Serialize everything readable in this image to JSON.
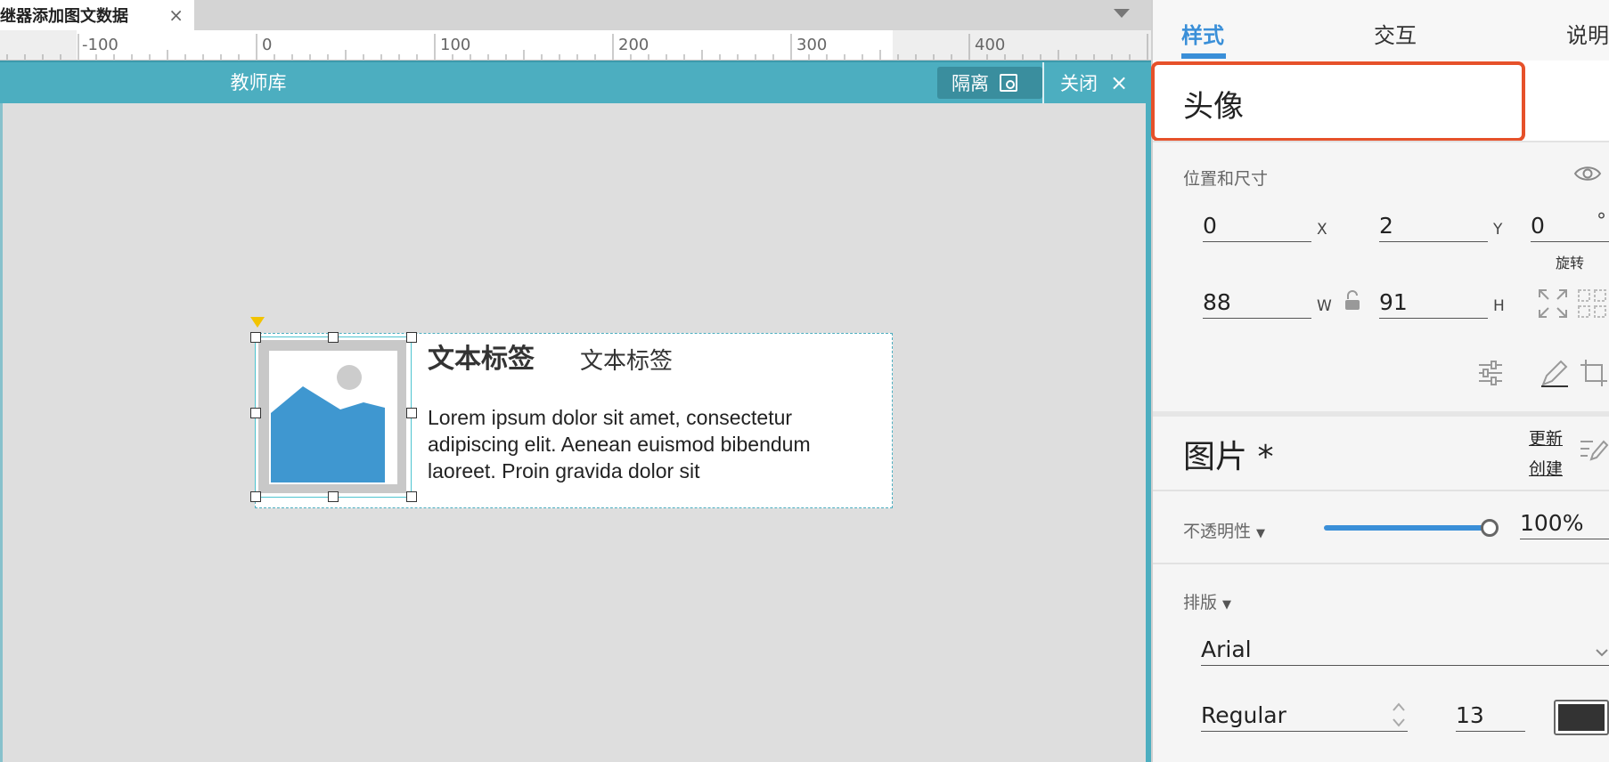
{
  "document_tab": {
    "label": "继器添加图文数据",
    "close": "×"
  },
  "ruler": {
    "labels": [
      "-100",
      "0",
      "100",
      "200",
      "300",
      "400"
    ]
  },
  "isolation_bar": {
    "title": "教师库",
    "isolate_label": "隔离",
    "close_label": "关闭",
    "close_glyph": "×"
  },
  "canvas": {
    "label_bold": "文本标签",
    "label_normal": "文本标签",
    "paragraph": "Lorem ipsum dolor sit amet, consectetur adipiscing elit. Aenean euismod bibendum laoreet. Proin gravida dolor sit"
  },
  "inspector": {
    "tabs": [
      {
        "label": "样式"
      },
      {
        "label": "交互"
      },
      {
        "label": "说明"
      }
    ],
    "widget_name": "头像",
    "position_size": {
      "label": "位置和尺寸",
      "x": "0",
      "x_unit": "X",
      "y": "2",
      "y_unit": "Y",
      "rotation": "0",
      "rotation_unit": "°",
      "rotation_label": "旋转",
      "w": "88",
      "w_unit": "W",
      "h": "91",
      "h_unit": "H"
    },
    "image_section": {
      "title": "图片 *",
      "update_link": "更新",
      "create_link": "创建"
    },
    "opacity": {
      "label": "不透明性",
      "value": "100%",
      "level": 1.0
    },
    "typography": {
      "label": "排版",
      "font": "Arial",
      "weight": "Regular",
      "size": "13",
      "color": "#333333"
    }
  },
  "colors": {
    "accent_teal": "#4caec0",
    "accent_blue": "#3a8fd8",
    "highlight": "#e6512a",
    "image_blue": "#3f97d0"
  }
}
